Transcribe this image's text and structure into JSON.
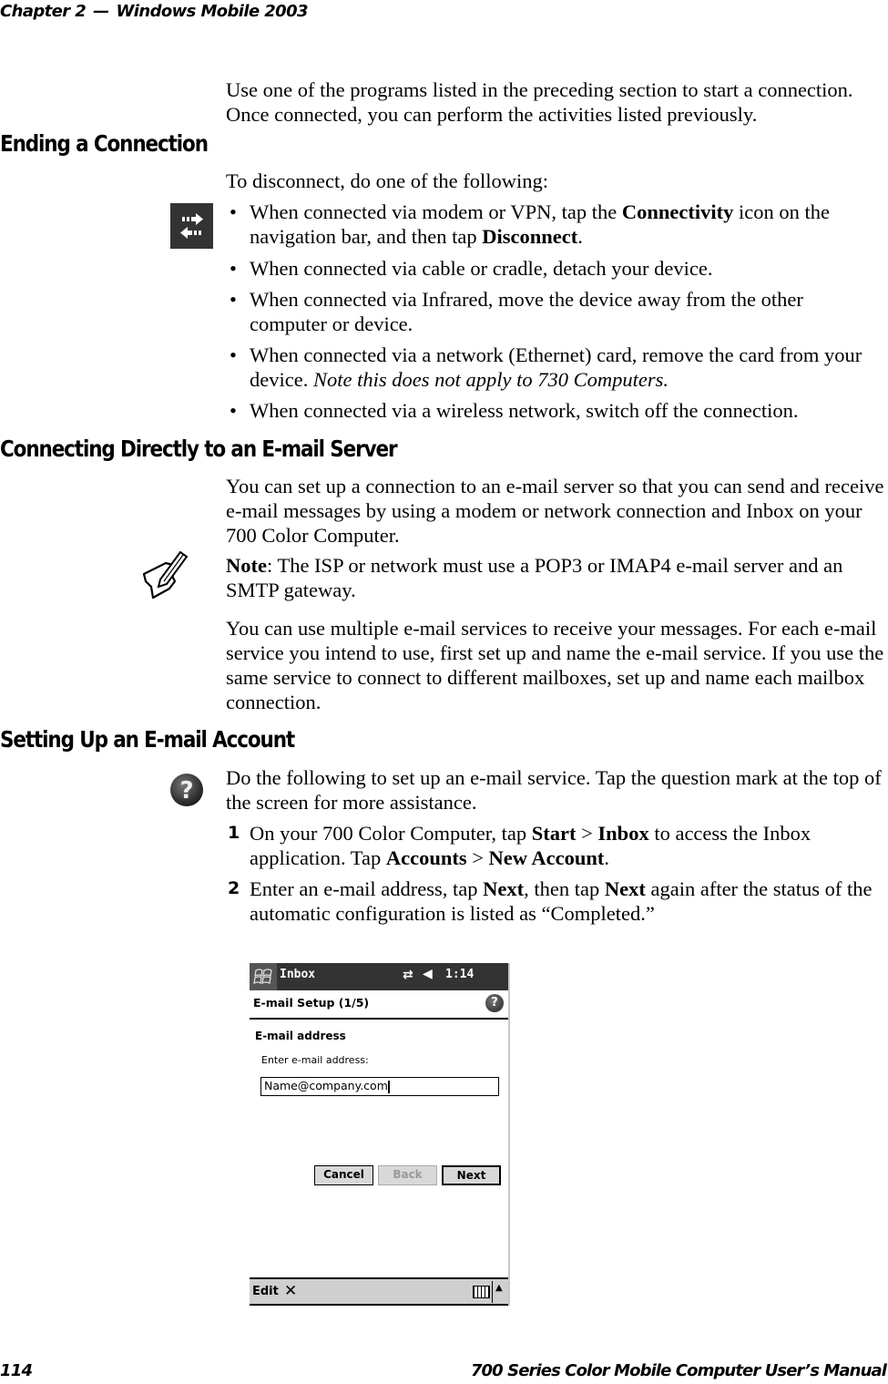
{
  "header": {
    "chapter": "Chapter 2",
    "separator": "—",
    "chapter_title": "Windows Mobile 2003"
  },
  "intro": {
    "text": "Use one of the programs listed in the preceding section to start a connection. Once connected, you can perform the activities listed previously."
  },
  "ending": {
    "heading": "Ending a Connection",
    "lead": "To disconnect, do one of the following:",
    "icon": "connectivity-icon",
    "bullets": [
      {
        "pre": "When connected via modem or VPN, tap the ",
        "b1": "Connectivity",
        "mid": " icon on the navigation bar, and then tap ",
        "b2": "Disconnect",
        "post": "."
      },
      {
        "text": "When connected via cable or cradle, detach your device."
      },
      {
        "text": "When connected via Infrared, move the device away from the other computer or device."
      },
      {
        "text": "When connected via a network (Ethernet) card, remove the card from your device. ",
        "italic": "Note this does not apply to 730 Computers."
      },
      {
        "text": "When connected via a wireless network, switch off the connection."
      }
    ]
  },
  "direct": {
    "heading": "Connecting Directly to an E-mail Server",
    "para1": "You can set up a connection to an e-mail server so that you can send and receive e-mail messages by using a modem or network connection and Inbox on your 700 Color Computer.",
    "note_icon": "note-pencil-icon",
    "note_label": "Note",
    "note_text": ": The ISP or network must use a POP3 or IMAP4 e-mail server and an SMTP gateway.",
    "para2": "You can use multiple e-mail services to receive your messages. For each e-mail service you intend to use, first set up and name the e-mail service. If you use the same service to connect to different mailboxes, set up and name each mailbox connection."
  },
  "setup": {
    "heading": "Setting Up an E-mail Account",
    "help_icon": "help-icon",
    "lead": "Do the following to set up an e-mail service. Tap the question mark at the top of the screen for more assistance.",
    "steps": [
      {
        "num": "1",
        "t1": "On your 700 Color Computer, tap ",
        "b1": "Start",
        "t2": " > ",
        "b2": "Inbox",
        "t3": " to access the Inbox application. Tap ",
        "b3": "Accounts",
        "t4": " > ",
        "b4": "New Account",
        "t5": "."
      },
      {
        "num": "2",
        "t1": "Enter an e-mail address, tap ",
        "b1": "Next",
        "t2": ", then tap ",
        "b2": "Next",
        "t3": " again after the status of the automatic configuration is listed as “Completed.”"
      }
    ]
  },
  "device": {
    "nav_title": "Inbox",
    "time": "1:14",
    "conn_glyph": "⇄",
    "vol_glyph": "◀",
    "screen_title": "E-mail Setup (1/5)",
    "help_glyph": "?",
    "section_label": "E-mail address",
    "field_label": "Enter e-mail address:",
    "email_value": "Name@company.com",
    "buttons": {
      "cancel": "Cancel",
      "back": "Back",
      "next": "Next"
    },
    "menu": {
      "edit": "Edit",
      "x_glyph": "✕",
      "sip_arrow": "▲"
    }
  },
  "footer": {
    "page_number": "114",
    "manual_title": "700 Series Color Mobile Computer User’s Manual"
  }
}
